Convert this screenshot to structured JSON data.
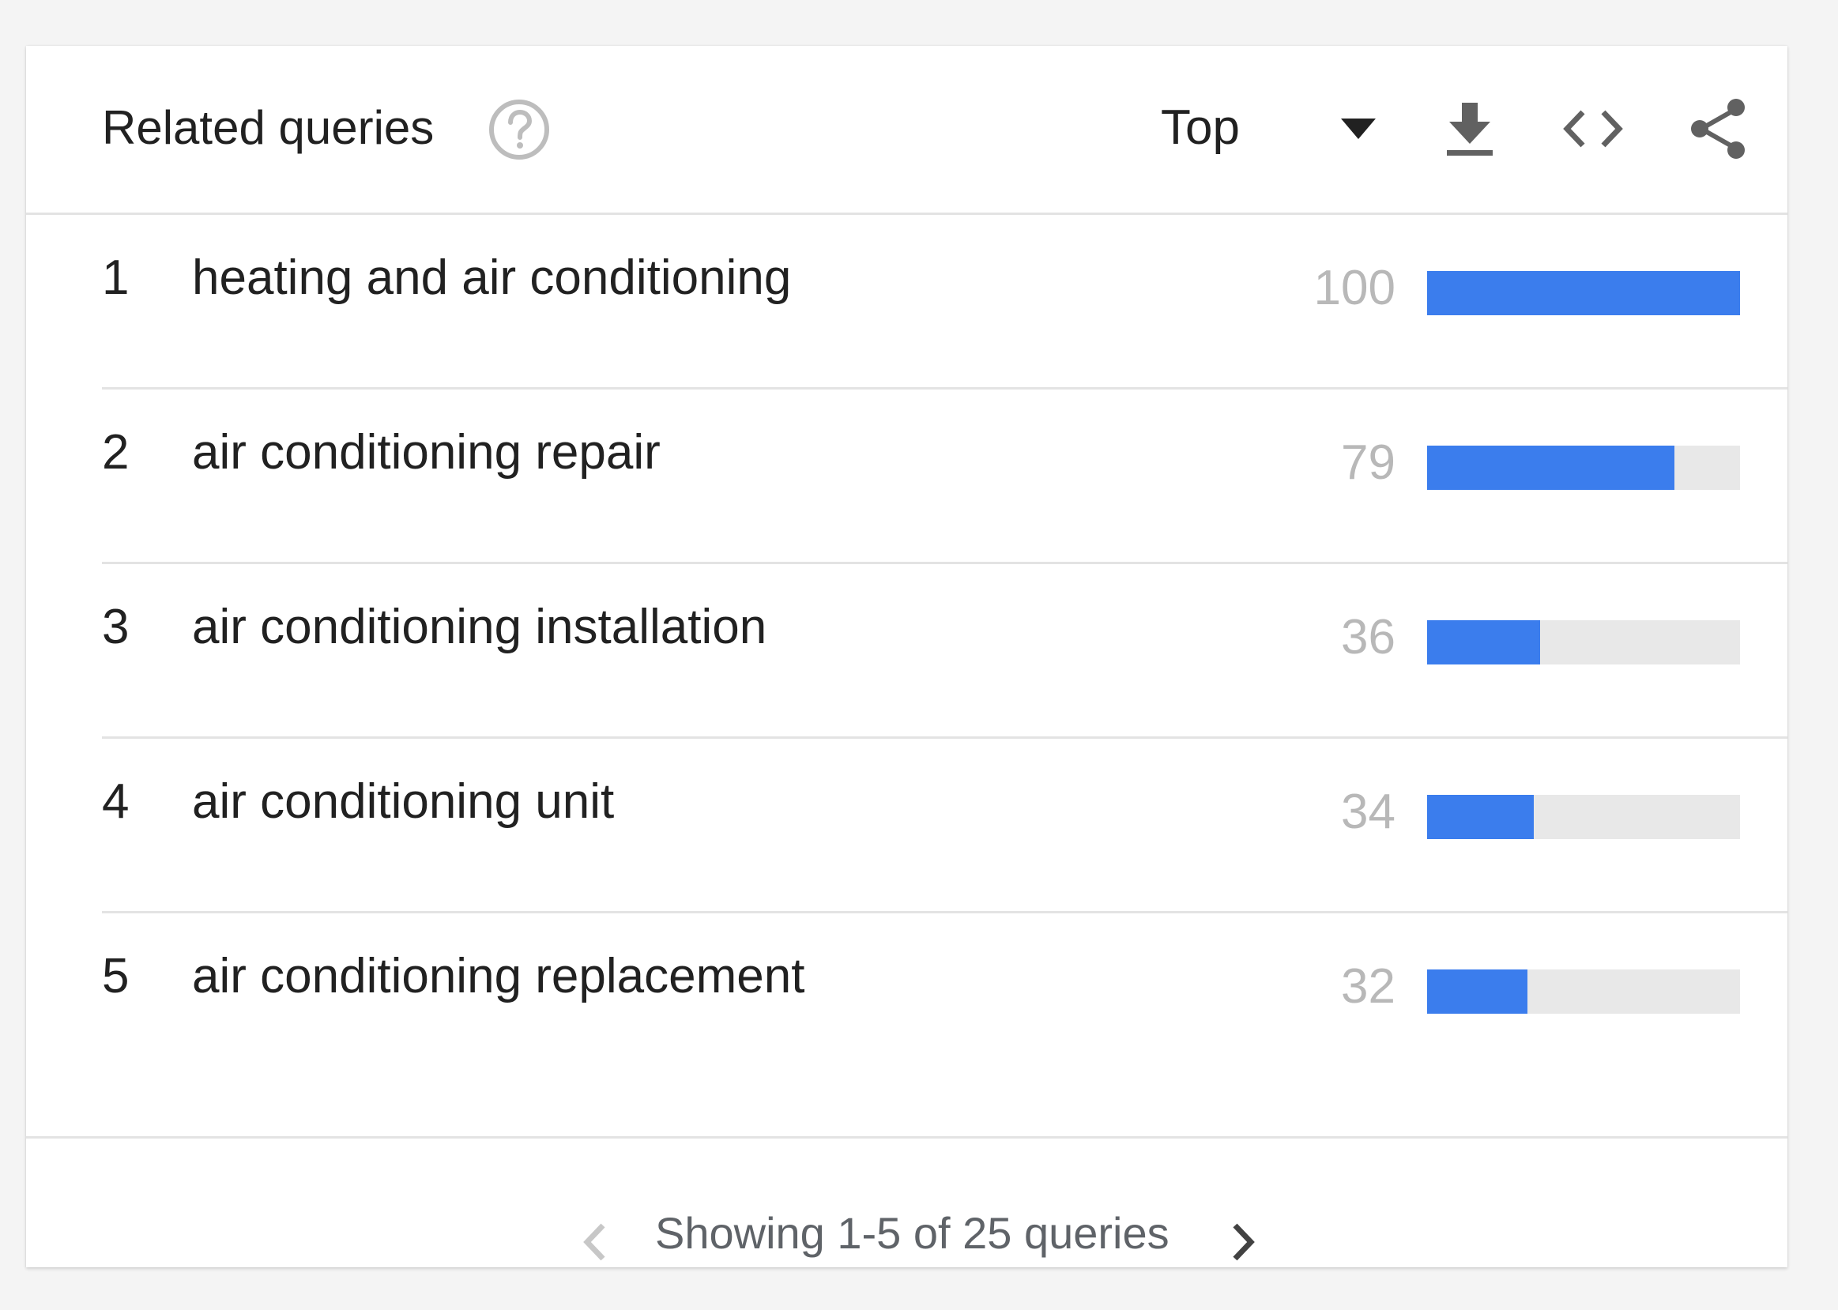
{
  "widget": {
    "title": "Related queries",
    "dropdown_label": "Top",
    "icons": {
      "help": "help-circle-icon",
      "dropdown": "caret-down-icon",
      "download": "download-icon",
      "embed": "code-embed-icon",
      "share": "share-icon"
    }
  },
  "queries": [
    {
      "rank": "1",
      "query": "heating and air conditioning",
      "value": "100",
      "level": 100
    },
    {
      "rank": "2",
      "query": "air conditioning repair",
      "value": "79",
      "level": 79
    },
    {
      "rank": "3",
      "query": "air conditioning installation",
      "value": "36",
      "level": 36
    },
    {
      "rank": "4",
      "query": "air conditioning unit",
      "value": "34",
      "level": 34
    },
    {
      "rank": "5",
      "query": "air conditioning replacement",
      "value": "32",
      "level": 32
    }
  ],
  "pagination": {
    "text": "Showing 1-5 of 25 queries",
    "prev_icon": "chevron-left-icon",
    "next_icon": "chevron-right-icon"
  },
  "colors": {
    "bar_fill": "#3b7ded",
    "bar_track": "#e8e8e8",
    "value_text": "#b8b8b8"
  }
}
